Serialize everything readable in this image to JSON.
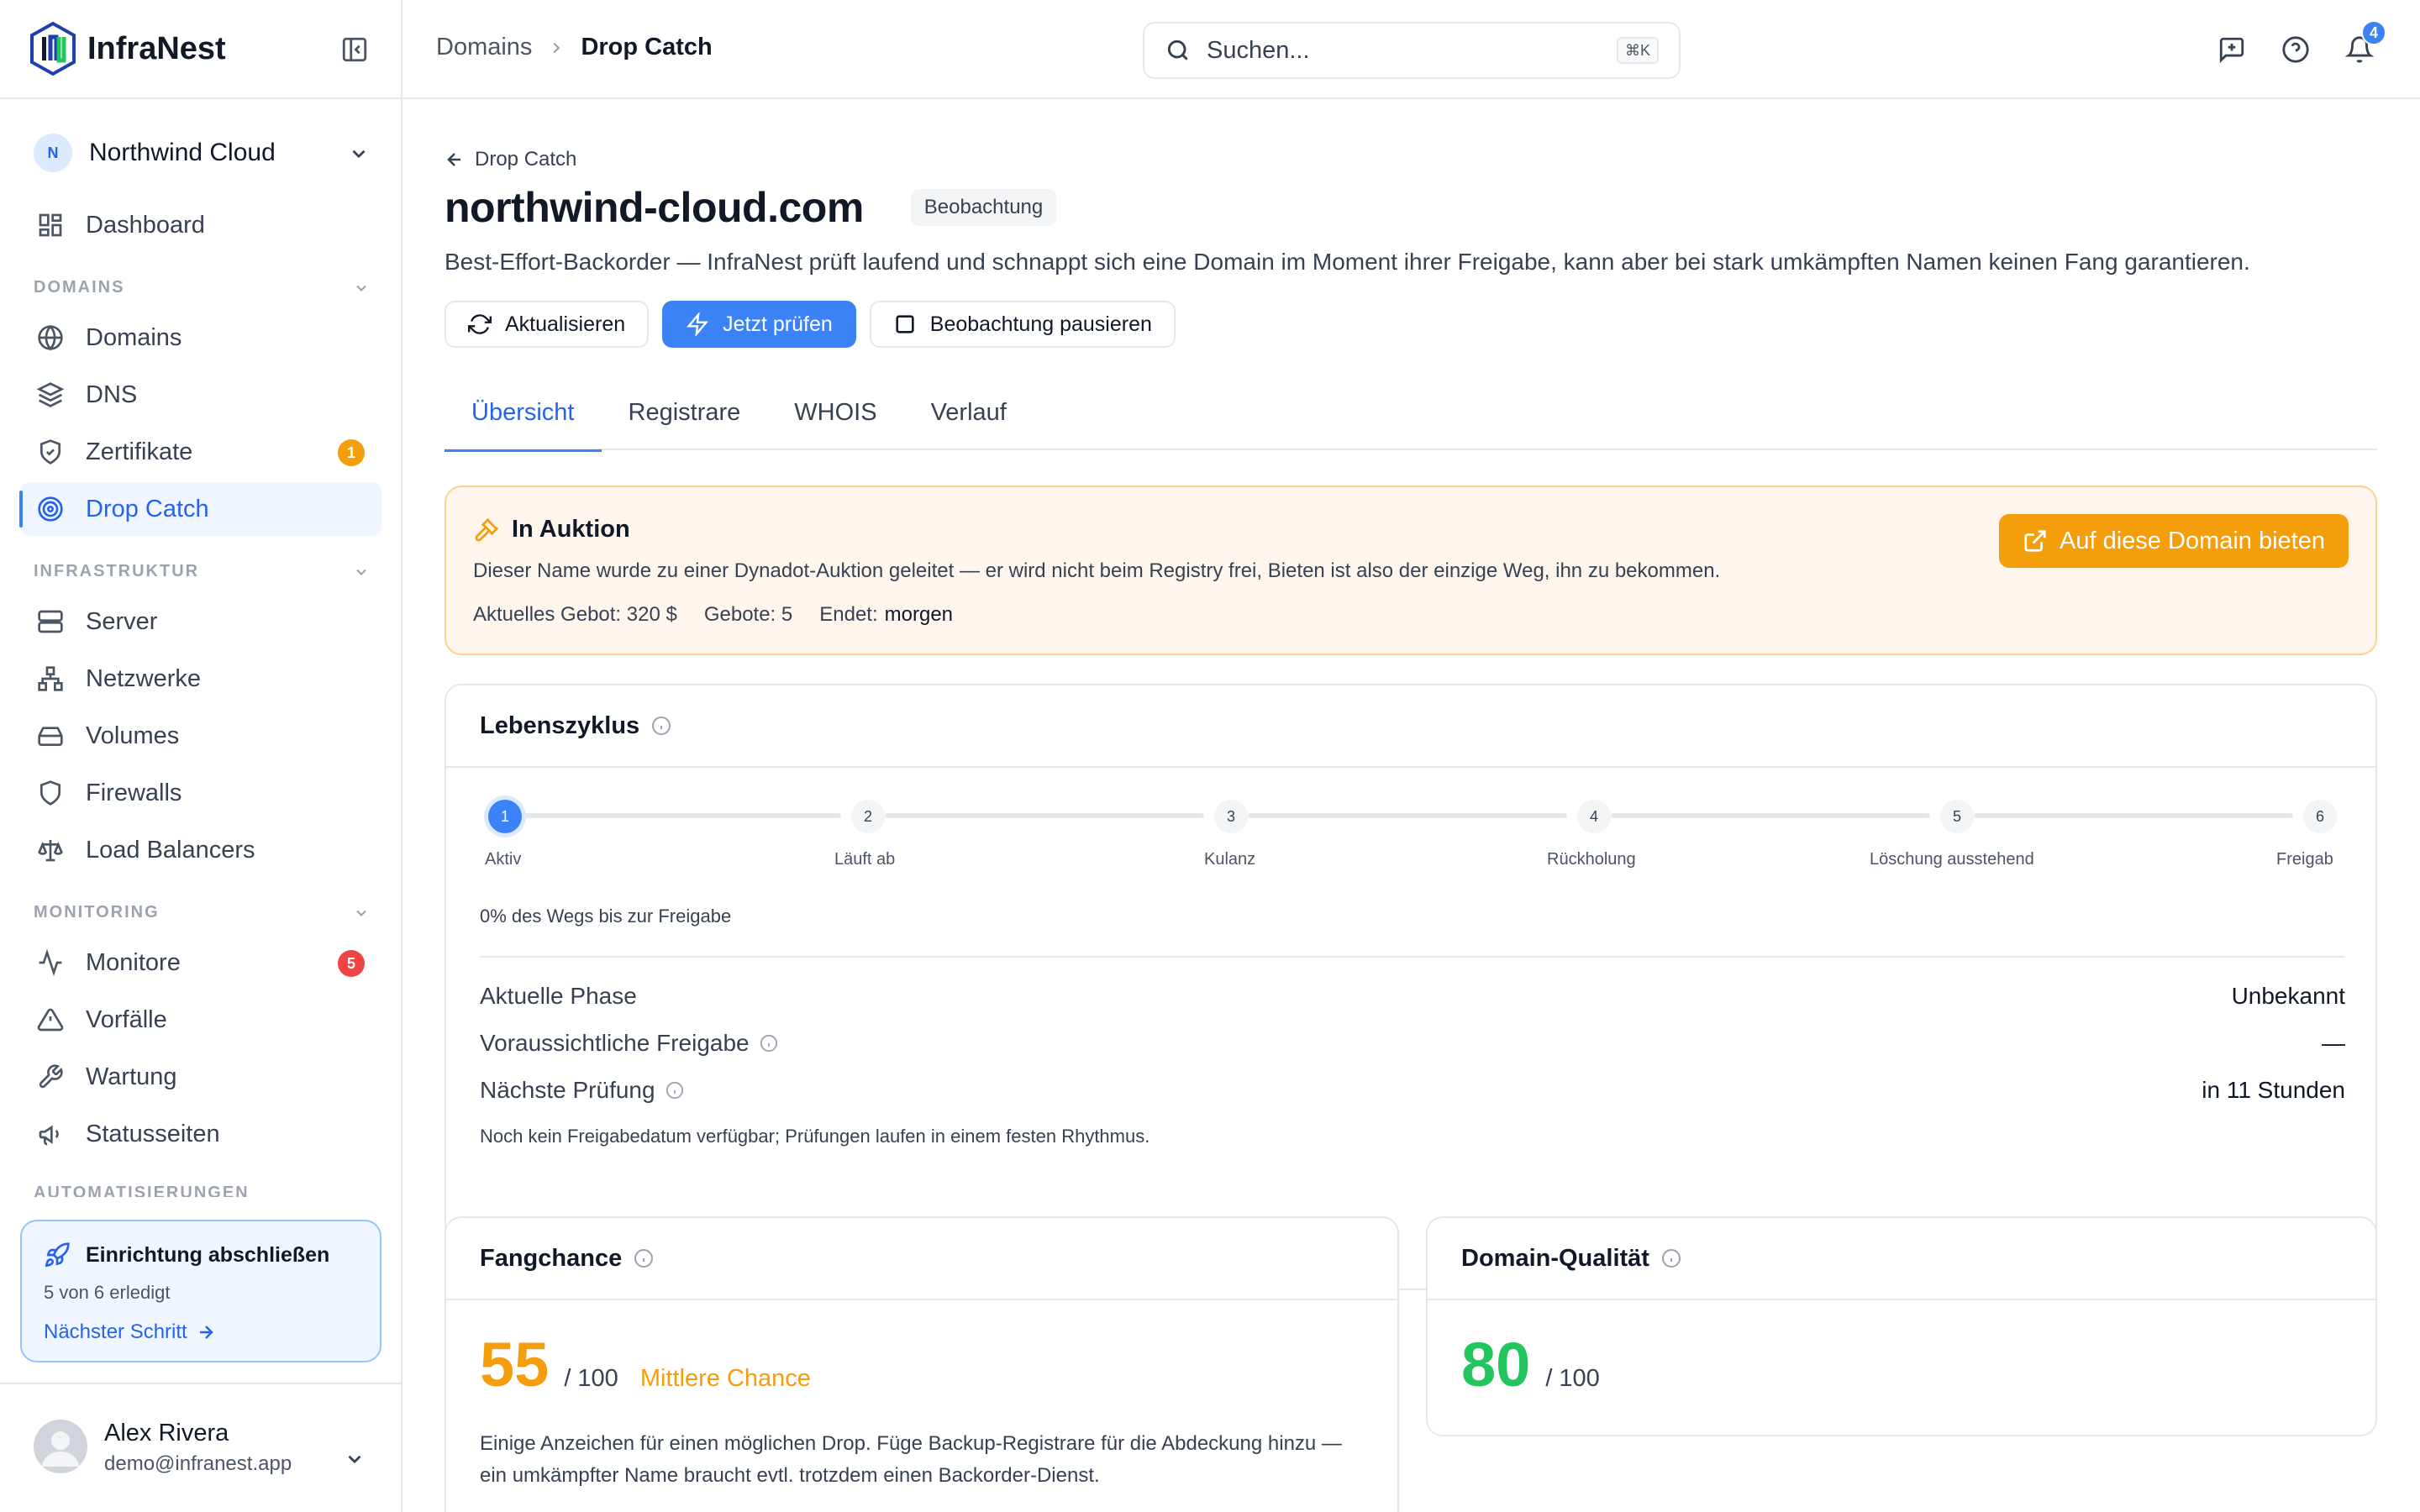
{
  "app": {
    "name": "InfraNest"
  },
  "org": {
    "initial": "N",
    "name": "Northwind Cloud"
  },
  "sidebar": {
    "dashboard": "Dashboard",
    "sections": {
      "domains": "DOMAINS",
      "infra": "INFRASTRUKTUR",
      "monitoring": "MONITORING",
      "automation": "AUTOMATISIERUNGEN"
    },
    "items": {
      "domains": "Domains",
      "dns": "DNS",
      "certs": "Zertifikate",
      "certs_badge": "1",
      "dropcatch": "Drop Catch",
      "server": "Server",
      "networks": "Netzwerke",
      "volumes": "Volumes",
      "firewalls": "Firewalls",
      "lb": "Load Balancers",
      "monitors": "Monitore",
      "monitors_badge": "5",
      "incidents": "Vorfälle",
      "maintenance": "Wartung",
      "statuspages": "Statusseiten"
    }
  },
  "setup": {
    "title": "Einrichtung abschließen",
    "progress": "5 von 6 erledigt",
    "next": "Nächster Schritt"
  },
  "user": {
    "name": "Alex Rivera",
    "email": "demo@infranest.app"
  },
  "topbar": {
    "crumb1": "Domains",
    "crumb2": "Drop Catch",
    "search_placeholder": "Suchen...",
    "shortcut": "⌘K",
    "notifications": "4"
  },
  "page": {
    "back": "Drop Catch",
    "domain": "northwind-cloud.com",
    "status": "Beobachtung",
    "description": "Best-Effort-Backorder — InfraNest prüft laufend und schnappt sich eine Domain im Moment ihrer Freigabe, kann aber bei stark umkämpften Namen keinen Fang garantieren.",
    "actions": {
      "refresh": "Aktualisieren",
      "check": "Jetzt prüfen",
      "pause": "Beobachtung pausieren"
    },
    "tabs": [
      "Übersicht",
      "Registrare",
      "WHOIS",
      "Verlauf"
    ]
  },
  "auction": {
    "title": "In Auktion",
    "description": "Dieser Name wurde zu einer Dynadot-Auktion geleitet — er wird nicht beim Registry frei, Bieten ist also der einzige Weg, ihn zu bekommen.",
    "bid": "Aktuelles Gebot: 320 $",
    "bids": "Gebote: 5",
    "ends_label": "Endet:",
    "ends_value": "morgen",
    "button": "Auf diese Domain bieten"
  },
  "lifecycle": {
    "title": "Lebenszyklus",
    "steps": [
      {
        "n": "1",
        "label": "Aktiv"
      },
      {
        "n": "2",
        "label": "Läuft ab"
      },
      {
        "n": "3",
        "label": "Kulanz"
      },
      {
        "n": "4",
        "label": "Rückholung"
      },
      {
        "n": "5",
        "label": "Löschung ausstehend"
      },
      {
        "n": "6",
        "label": "Freigab"
      }
    ],
    "progress": "0% des Wegs bis zur Freigabe",
    "phase_label": "Aktuelle Phase",
    "phase_value": "Unbekannt",
    "release_label": "Voraussichtliche Freigabe",
    "release_value": "—",
    "next_label": "Nächste Prüfung",
    "next_value": "in 11 Stunden",
    "note": "Noch kein Freigabedatum verfügbar; Prüfungen laufen in einem festen Rhythmus."
  },
  "chance": {
    "title": "Fangchance",
    "score": "55",
    "max": "/ 100",
    "label": "Mittlere Chance",
    "description": "Einige Anzeichen für einen möglichen Drop. Füge Backup-Registrare für die Abdeckung hinzu — ein umkämpfter Name braucht evtl. trotzdem einen Backorder-Dienst.",
    "color": "#f59e0b"
  },
  "quality": {
    "title": "Domain-Qualität",
    "score": "80",
    "max": "/ 100",
    "color": "#22c55e"
  },
  "colors": {
    "accent": "#3b82f6",
    "warning": "#f59e0b",
    "danger": "#ef4444",
    "success": "#22c55e"
  }
}
